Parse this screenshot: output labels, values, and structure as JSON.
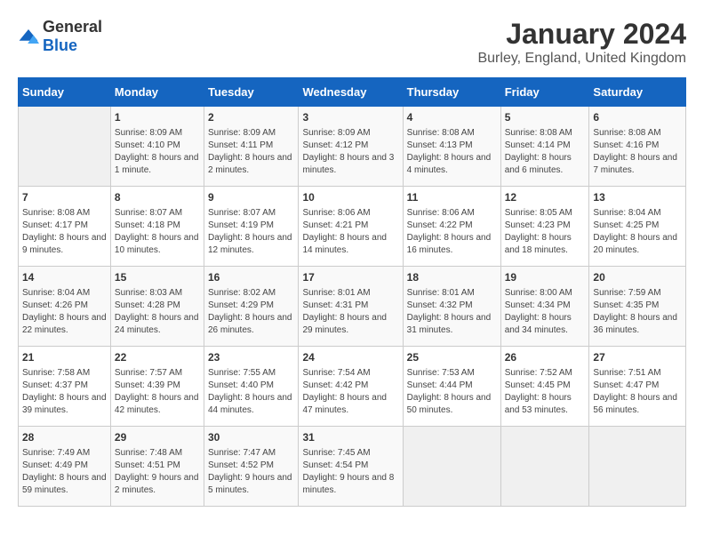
{
  "logo": {
    "general": "General",
    "blue": "Blue"
  },
  "title": "January 2024",
  "location": "Burley, England, United Kingdom",
  "days_of_week": [
    "Sunday",
    "Monday",
    "Tuesday",
    "Wednesday",
    "Thursday",
    "Friday",
    "Saturday"
  ],
  "weeks": [
    [
      {
        "day": "",
        "empty": true
      },
      {
        "day": "1",
        "sunrise": "Sunrise: 8:09 AM",
        "sunset": "Sunset: 4:10 PM",
        "daylight": "Daylight: 8 hours and 1 minute."
      },
      {
        "day": "2",
        "sunrise": "Sunrise: 8:09 AM",
        "sunset": "Sunset: 4:11 PM",
        "daylight": "Daylight: 8 hours and 2 minutes."
      },
      {
        "day": "3",
        "sunrise": "Sunrise: 8:09 AM",
        "sunset": "Sunset: 4:12 PM",
        "daylight": "Daylight: 8 hours and 3 minutes."
      },
      {
        "day": "4",
        "sunrise": "Sunrise: 8:08 AM",
        "sunset": "Sunset: 4:13 PM",
        "daylight": "Daylight: 8 hours and 4 minutes."
      },
      {
        "day": "5",
        "sunrise": "Sunrise: 8:08 AM",
        "sunset": "Sunset: 4:14 PM",
        "daylight": "Daylight: 8 hours and 6 minutes."
      },
      {
        "day": "6",
        "sunrise": "Sunrise: 8:08 AM",
        "sunset": "Sunset: 4:16 PM",
        "daylight": "Daylight: 8 hours and 7 minutes."
      }
    ],
    [
      {
        "day": "7",
        "sunrise": "Sunrise: 8:08 AM",
        "sunset": "Sunset: 4:17 PM",
        "daylight": "Daylight: 8 hours and 9 minutes."
      },
      {
        "day": "8",
        "sunrise": "Sunrise: 8:07 AM",
        "sunset": "Sunset: 4:18 PM",
        "daylight": "Daylight: 8 hours and 10 minutes."
      },
      {
        "day": "9",
        "sunrise": "Sunrise: 8:07 AM",
        "sunset": "Sunset: 4:19 PM",
        "daylight": "Daylight: 8 hours and 12 minutes."
      },
      {
        "day": "10",
        "sunrise": "Sunrise: 8:06 AM",
        "sunset": "Sunset: 4:21 PM",
        "daylight": "Daylight: 8 hours and 14 minutes."
      },
      {
        "day": "11",
        "sunrise": "Sunrise: 8:06 AM",
        "sunset": "Sunset: 4:22 PM",
        "daylight": "Daylight: 8 hours and 16 minutes."
      },
      {
        "day": "12",
        "sunrise": "Sunrise: 8:05 AM",
        "sunset": "Sunset: 4:23 PM",
        "daylight": "Daylight: 8 hours and 18 minutes."
      },
      {
        "day": "13",
        "sunrise": "Sunrise: 8:04 AM",
        "sunset": "Sunset: 4:25 PM",
        "daylight": "Daylight: 8 hours and 20 minutes."
      }
    ],
    [
      {
        "day": "14",
        "sunrise": "Sunrise: 8:04 AM",
        "sunset": "Sunset: 4:26 PM",
        "daylight": "Daylight: 8 hours and 22 minutes."
      },
      {
        "day": "15",
        "sunrise": "Sunrise: 8:03 AM",
        "sunset": "Sunset: 4:28 PM",
        "daylight": "Daylight: 8 hours and 24 minutes."
      },
      {
        "day": "16",
        "sunrise": "Sunrise: 8:02 AM",
        "sunset": "Sunset: 4:29 PM",
        "daylight": "Daylight: 8 hours and 26 minutes."
      },
      {
        "day": "17",
        "sunrise": "Sunrise: 8:01 AM",
        "sunset": "Sunset: 4:31 PM",
        "daylight": "Daylight: 8 hours and 29 minutes."
      },
      {
        "day": "18",
        "sunrise": "Sunrise: 8:01 AM",
        "sunset": "Sunset: 4:32 PM",
        "daylight": "Daylight: 8 hours and 31 minutes."
      },
      {
        "day": "19",
        "sunrise": "Sunrise: 8:00 AM",
        "sunset": "Sunset: 4:34 PM",
        "daylight": "Daylight: 8 hours and 34 minutes."
      },
      {
        "day": "20",
        "sunrise": "Sunrise: 7:59 AM",
        "sunset": "Sunset: 4:35 PM",
        "daylight": "Daylight: 8 hours and 36 minutes."
      }
    ],
    [
      {
        "day": "21",
        "sunrise": "Sunrise: 7:58 AM",
        "sunset": "Sunset: 4:37 PM",
        "daylight": "Daylight: 8 hours and 39 minutes."
      },
      {
        "day": "22",
        "sunrise": "Sunrise: 7:57 AM",
        "sunset": "Sunset: 4:39 PM",
        "daylight": "Daylight: 8 hours and 42 minutes."
      },
      {
        "day": "23",
        "sunrise": "Sunrise: 7:55 AM",
        "sunset": "Sunset: 4:40 PM",
        "daylight": "Daylight: 8 hours and 44 minutes."
      },
      {
        "day": "24",
        "sunrise": "Sunrise: 7:54 AM",
        "sunset": "Sunset: 4:42 PM",
        "daylight": "Daylight: 8 hours and 47 minutes."
      },
      {
        "day": "25",
        "sunrise": "Sunrise: 7:53 AM",
        "sunset": "Sunset: 4:44 PM",
        "daylight": "Daylight: 8 hours and 50 minutes."
      },
      {
        "day": "26",
        "sunrise": "Sunrise: 7:52 AM",
        "sunset": "Sunset: 4:45 PM",
        "daylight": "Daylight: 8 hours and 53 minutes."
      },
      {
        "day": "27",
        "sunrise": "Sunrise: 7:51 AM",
        "sunset": "Sunset: 4:47 PM",
        "daylight": "Daylight: 8 hours and 56 minutes."
      }
    ],
    [
      {
        "day": "28",
        "sunrise": "Sunrise: 7:49 AM",
        "sunset": "Sunset: 4:49 PM",
        "daylight": "Daylight: 8 hours and 59 minutes."
      },
      {
        "day": "29",
        "sunrise": "Sunrise: 7:48 AM",
        "sunset": "Sunset: 4:51 PM",
        "daylight": "Daylight: 9 hours and 2 minutes."
      },
      {
        "day": "30",
        "sunrise": "Sunrise: 7:47 AM",
        "sunset": "Sunset: 4:52 PM",
        "daylight": "Daylight: 9 hours and 5 minutes."
      },
      {
        "day": "31",
        "sunrise": "Sunrise: 7:45 AM",
        "sunset": "Sunset: 4:54 PM",
        "daylight": "Daylight: 9 hours and 8 minutes."
      },
      {
        "day": "",
        "empty": true
      },
      {
        "day": "",
        "empty": true
      },
      {
        "day": "",
        "empty": true
      }
    ]
  ]
}
